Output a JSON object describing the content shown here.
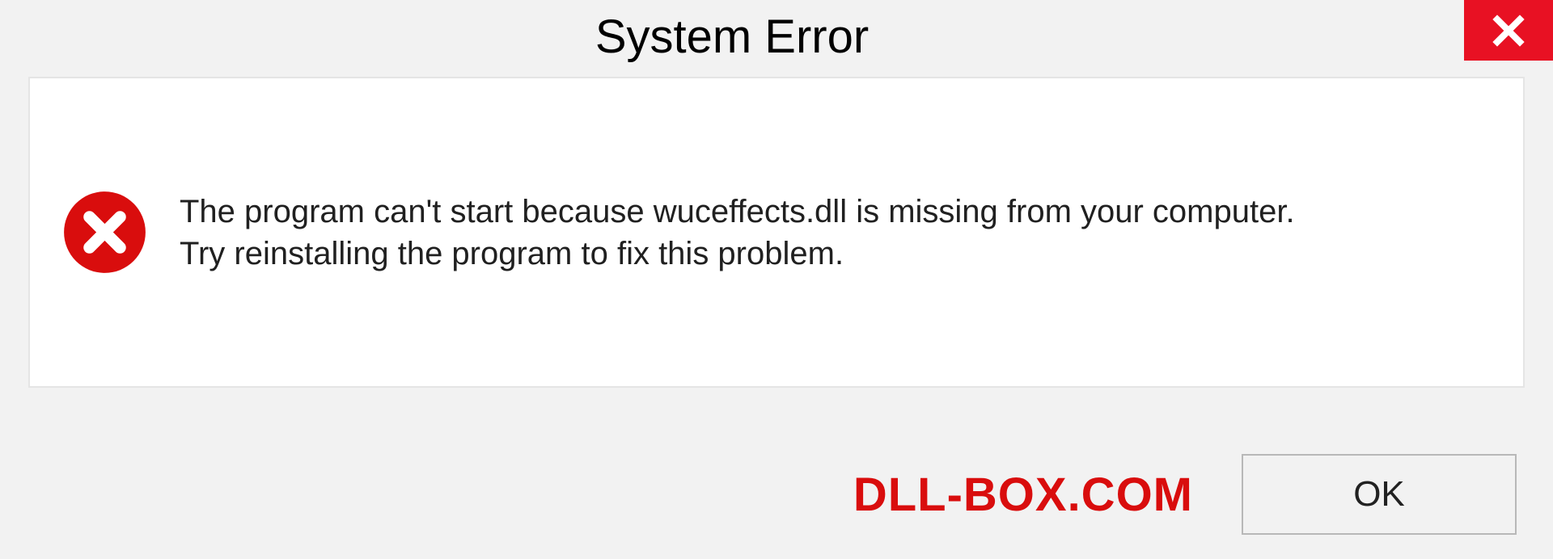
{
  "dialog": {
    "title": "System Error",
    "message": "The program can't start because wuceffects.dll is missing from your computer. Try reinstalling the program to fix this problem.",
    "ok_label": "OK"
  },
  "watermark": "DLL-BOX.COM",
  "colors": {
    "close_bg": "#e81123",
    "error_circle": "#d90d0d",
    "watermark": "#d90d0d"
  }
}
